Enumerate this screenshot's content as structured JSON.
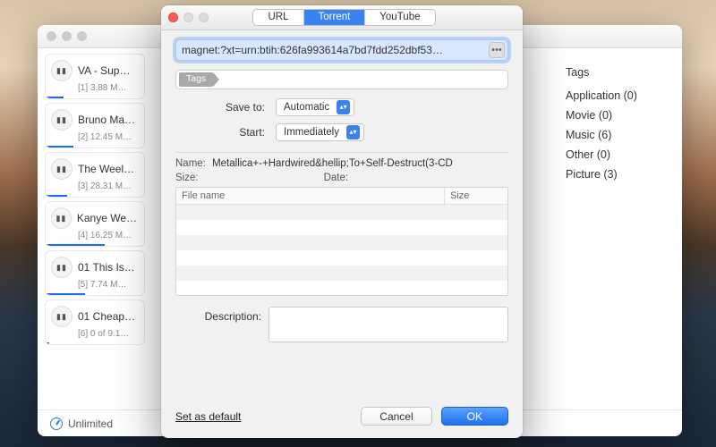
{
  "back_window": {
    "downloads": [
      {
        "title": "VA - Sup…",
        "sub": "[1]  3.88 M…",
        "progress": 18
      },
      {
        "title": "Bruno Ma…",
        "sub": "[2]  12.45 M…",
        "progress": 28
      },
      {
        "title": "The Weel…",
        "sub": "[3]  28.31 M…",
        "progress": 22
      },
      {
        "title": "Kanye We…",
        "sub": "[4]  16.25 M…",
        "progress": 60
      },
      {
        "title": "01 This Is…",
        "sub": "[5]  7.74 M…",
        "progress": 40
      },
      {
        "title": "01 Cheap…",
        "sub": "[6]  0 of 9.1…",
        "progress": 4
      }
    ],
    "sidebar": {
      "header": "Tags",
      "items": [
        {
          "label": "Application (0)"
        },
        {
          "label": "Movie (0)"
        },
        {
          "label": "Music (6)"
        },
        {
          "label": "Other (0)"
        },
        {
          "label": "Picture (3)"
        }
      ]
    },
    "footer_speed": "Unlimited"
  },
  "modal": {
    "tabs": {
      "url": "URL",
      "torrent": "Torrent",
      "youtube": "YouTube"
    },
    "url_value": "magnet:?xt=urn:btih:626fa993614a7bd7fdd252dbf53…",
    "tags_chip": "Tags",
    "save_to_label": "Save to:",
    "save_to_value": "Automatic",
    "start_label": "Start:",
    "start_value": "Immediately",
    "name_label": "Name:",
    "name_value": "Metallica+-+Hardwired&hellip;To+Self-Destruct(3-CD",
    "size_label": "Size:",
    "date_label": "Date:",
    "table": {
      "col_file": "File name",
      "col_size": "Size"
    },
    "description_label": "Description:",
    "set_default": "Set as default",
    "cancel": "Cancel",
    "ok": "OK"
  }
}
